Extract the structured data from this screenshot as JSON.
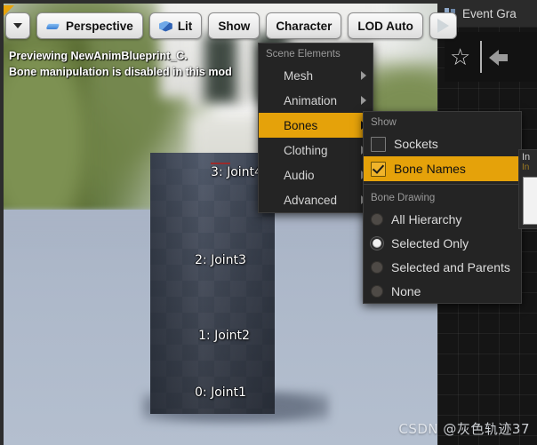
{
  "viewport": {
    "warning_line1": "Previewing NewAnimBlueprint_C.",
    "warning_line2": "Bone manipulation is disabled in this mod",
    "bone_labels": [
      {
        "text": "3: Joint4"
      },
      {
        "text": "2: Joint3"
      },
      {
        "text": "1: Joint2"
      },
      {
        "text": "0: Joint1"
      }
    ]
  },
  "toolbar": {
    "dropdown_icon": "chevron-down-icon",
    "perspective_label": "Perspective",
    "perspective_icon": "perspective-icon",
    "lit_label": "Lit",
    "lit_icon": "cube-icon",
    "show_label": "Show",
    "character_label": "Character",
    "lod_label": "LOD Auto",
    "play_icon": "play-icon"
  },
  "scene_menu": {
    "header": "Scene Elements",
    "items": [
      {
        "label": "Mesh",
        "highlighted": false
      },
      {
        "label": "Animation",
        "highlighted": false
      },
      {
        "label": "Bones",
        "highlighted": true
      },
      {
        "label": "Clothing",
        "highlighted": false
      },
      {
        "label": "Audio",
        "highlighted": false
      },
      {
        "label": "Advanced",
        "highlighted": false
      }
    ]
  },
  "bones_submenu": {
    "show_header": "Show",
    "checkboxes": [
      {
        "label": "Sockets",
        "checked": false,
        "highlighted": false
      },
      {
        "label": "Bone Names",
        "checked": true,
        "highlighted": true
      }
    ],
    "drawing_header": "Bone Drawing",
    "radios": [
      {
        "label": "All Hierarchy",
        "selected": false
      },
      {
        "label": "Selected Only",
        "selected": true
      },
      {
        "label": "Selected and Parents",
        "selected": false
      },
      {
        "label": "None",
        "selected": false
      }
    ]
  },
  "right_panel": {
    "tab_label": "Event Gra",
    "tab_icon": "graph-icon",
    "favorite_icon": "star-icon",
    "back_icon": "back-arrow-icon",
    "details_title": "In",
    "details_sub": "In"
  },
  "watermark": {
    "text": "CSDN @灰色轨迹37"
  },
  "colors": {
    "accent": "#e5a20a",
    "menu_bg": "#242424",
    "panel_bg": "#1d1d1d",
    "ground": "#aeb9ca"
  }
}
